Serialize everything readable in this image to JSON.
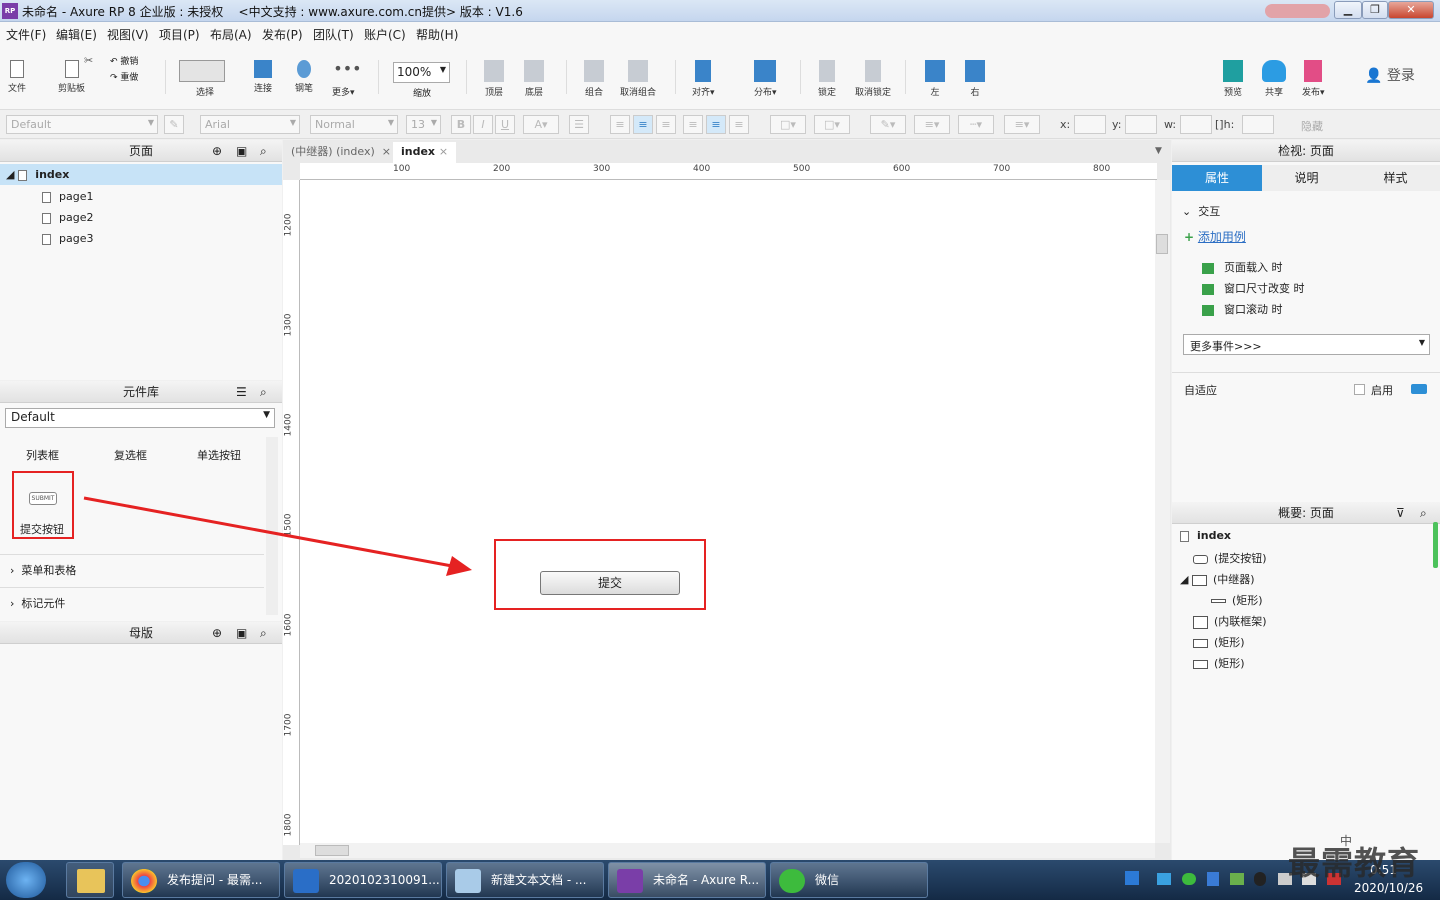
{
  "window": {
    "title": "未命名 - Axure RP 8 企业版 : 未授权",
    "support": "<中文支持 : www.axure.com.cn提供> 版本 : V1.6",
    "app_icon": "RP"
  },
  "menu": [
    "文件(F)",
    "编辑(E)",
    "视图(V)",
    "项目(P)",
    "布局(A)",
    "发布(P)",
    "团队(T)",
    "账户(C)",
    "帮助(H)"
  ],
  "toolbar": {
    "file": "文件",
    "clipboard": "剪贴板",
    "cut": "剪切",
    "undo": "撤销",
    "redo": "重做",
    "select": "选择",
    "connect": "连接",
    "pen": "钢笔",
    "more": "更多▾",
    "zoom_value": "100%",
    "zoom": "缩放",
    "top": "顶层",
    "bottom": "底层",
    "group": "组合",
    "ungroup": "取消组合",
    "align": "对齐▾",
    "distribute": "分布▾",
    "lock": "锁定",
    "unlock": "取消锁定",
    "left": "左",
    "right": "右",
    "preview": "预览",
    "share": "共享",
    "publish": "发布▾",
    "login": "登录"
  },
  "format": {
    "style": "Default",
    "font": "Arial",
    "weight": "Normal",
    "size": "13",
    "bold": "B",
    "italic": "I",
    "underline": "U",
    "x": "x:",
    "y": "y:",
    "w": "w:",
    "h": "h:",
    "hidden": "隐藏"
  },
  "pages_panel": {
    "title": "页面",
    "root": "index",
    "items": [
      "page1",
      "page2",
      "page3"
    ]
  },
  "library_panel": {
    "title": "元件库",
    "selected": "Default",
    "widgets": [
      "列表框",
      "复选框",
      "单选按钮"
    ],
    "submit_label": "提交按钮",
    "submit_icon_text": "SUBMIT",
    "sections": [
      "菜单和表格",
      "标记元件"
    ]
  },
  "masters_panel": {
    "title": "母版"
  },
  "canvas": {
    "tabs": [
      "(中继器) (index)",
      "index"
    ],
    "ruler_top": [
      "100",
      "200",
      "300",
      "400",
      "500",
      "600",
      "700",
      "800"
    ],
    "ruler_left": [
      "1200",
      "1300",
      "1400",
      "1500",
      "1600",
      "1700",
      "1800"
    ],
    "button_text": "提交"
  },
  "inspector": {
    "title": "检视: 页面",
    "tabs": [
      "属性",
      "说明",
      "样式"
    ],
    "interaction": "交互",
    "add_case": "添加用例",
    "events": [
      "页面载入 时",
      "窗口尺寸改变 时",
      "窗口滚动 时"
    ],
    "more_events": "更多事件>>>",
    "adaptive": "自适应",
    "enable": "启用"
  },
  "outline": {
    "title": "概要: 页面",
    "root": "index",
    "items": [
      "(提交按钮)",
      "(中继器)",
      "(矩形)",
      "(内联框架)",
      "(矩形)",
      "(矩形)"
    ]
  },
  "taskbar": {
    "items": [
      "发布提问 - 最需...",
      "2020102310091...",
      "新建文本文档 - ...",
      "未命名 - Axure R...",
      "微信"
    ],
    "time": "0:51",
    "date": "2020/10/26",
    "watermark": "最需教育",
    "ime": "中"
  },
  "colors": {
    "accent": "#2d8fd6",
    "highlight_red": "#e52222",
    "page_selected": "#c7e3f7"
  }
}
